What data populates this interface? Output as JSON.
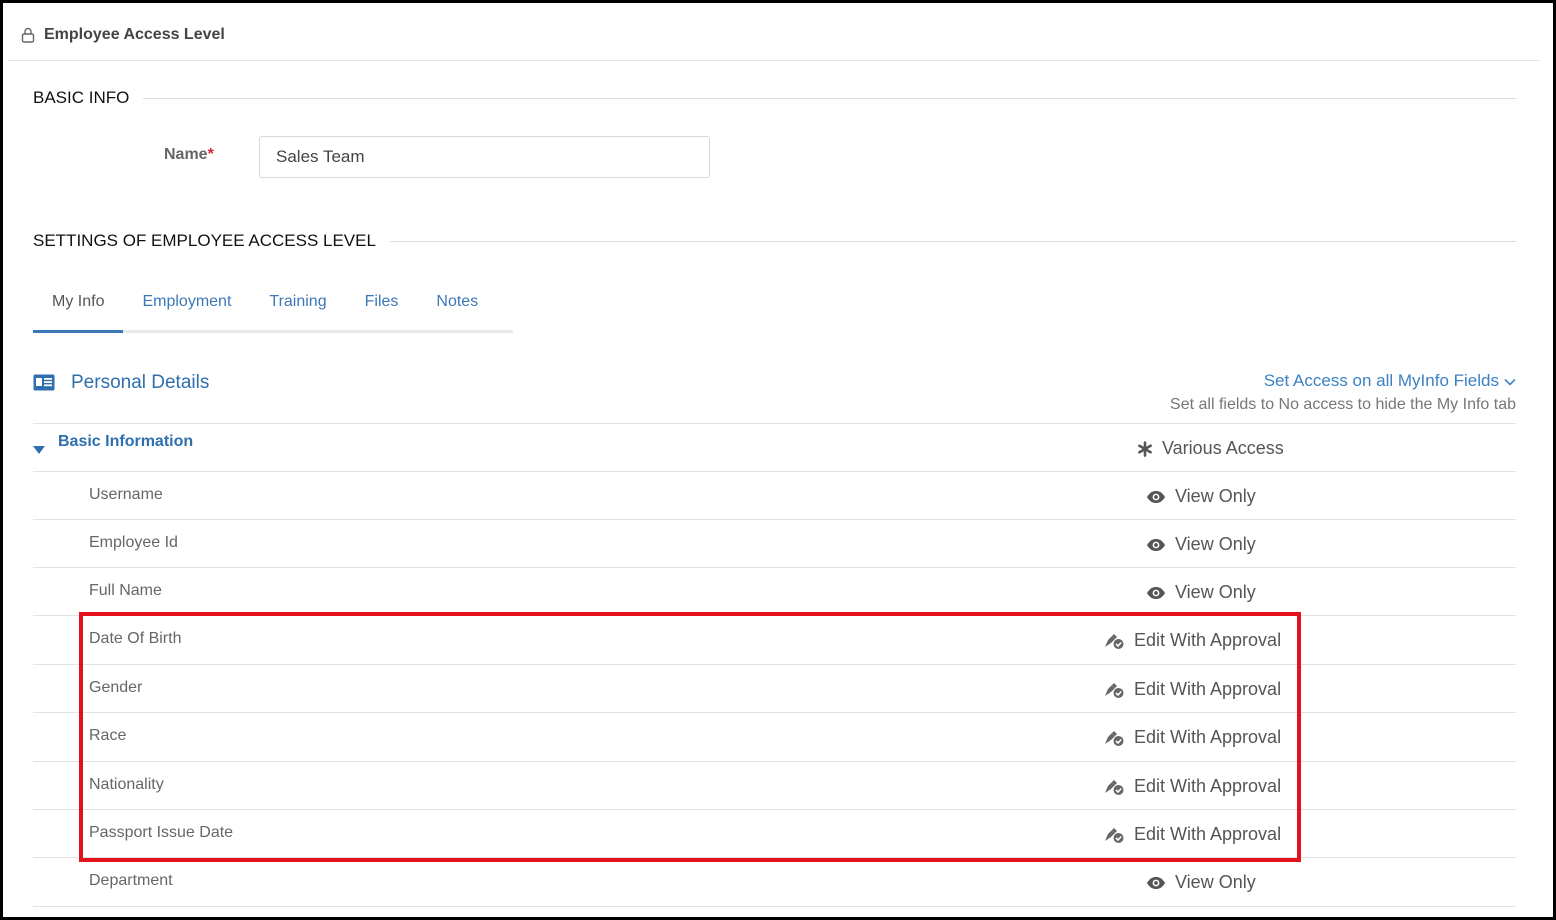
{
  "header": {
    "title": "Employee Access Level",
    "icon": "lock-icon"
  },
  "basic_info": {
    "heading": "BASIC INFO",
    "name_label": "Name",
    "name_required_mark": "*",
    "name_value": "Sales Team"
  },
  "settings": {
    "heading": "SETTINGS OF EMPLOYEE ACCESS LEVEL",
    "tabs": [
      {
        "label": "My Info",
        "active": true
      },
      {
        "label": "Employment",
        "active": false
      },
      {
        "label": "Training",
        "active": false
      },
      {
        "label": "Files",
        "active": false
      },
      {
        "label": "Notes",
        "active": false
      }
    ]
  },
  "personal_details": {
    "title": "Personal Details",
    "set_access_label": "Set Access on all MyInfo Fields",
    "set_access_hint": "Set all fields to No access to hide the My Info tab",
    "group": {
      "label": "Basic Information",
      "access": "Various Access"
    },
    "fields": [
      {
        "name": "Username",
        "access": "View Only",
        "icon": "eye-icon"
      },
      {
        "name": "Employee Id",
        "access": "View Only",
        "icon": "eye-icon"
      },
      {
        "name": "Full Name",
        "access": "View Only",
        "icon": "eye-icon"
      },
      {
        "name": "Date Of Birth",
        "access": "Edit With Approval",
        "icon": "edit-approval-icon"
      },
      {
        "name": "Gender",
        "access": "Edit With Approval",
        "icon": "edit-approval-icon"
      },
      {
        "name": "Race",
        "access": "Edit With Approval",
        "icon": "edit-approval-icon"
      },
      {
        "name": "Nationality",
        "access": "Edit With Approval",
        "icon": "edit-approval-icon"
      },
      {
        "name": "Passport Issue Date",
        "access": "Edit With Approval",
        "icon": "edit-approval-icon"
      },
      {
        "name": "Department",
        "access": "View Only",
        "icon": "eye-icon"
      }
    ]
  },
  "colors": {
    "accent": "#3b78b8",
    "highlight": "#e3121b",
    "required": "#d9232e"
  }
}
